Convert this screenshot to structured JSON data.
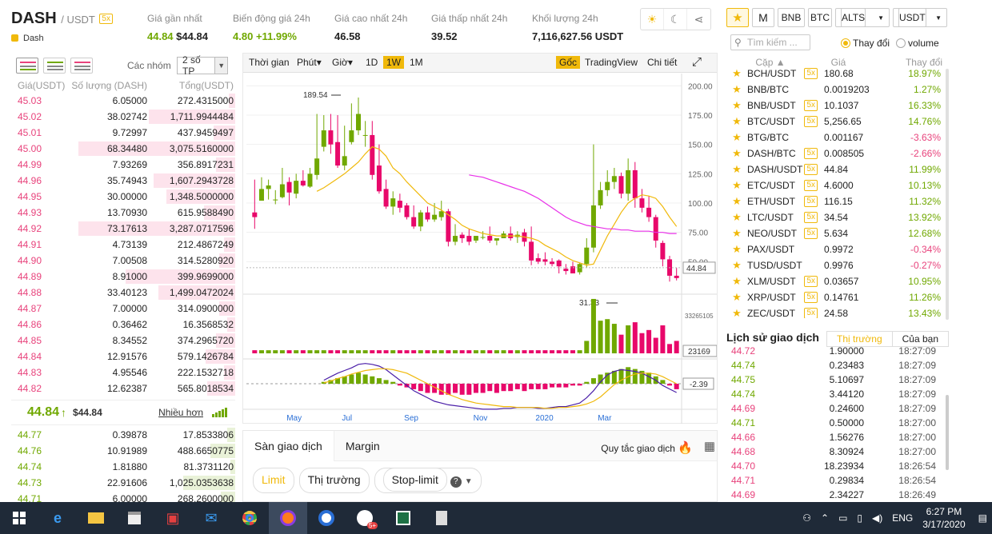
{
  "header": {
    "symbol": "DASH",
    "quote": "/ USDT",
    "leverage": "5x",
    "name": "Dash",
    "stats": [
      {
        "label": "Giá gần nhất",
        "value": "44.84",
        "value2": "$44.84"
      },
      {
        "label": "Biến động giá 24h",
        "value": "4.80",
        "value2": "+11.99%"
      },
      {
        "label": "Giá cao nhất 24h",
        "value": "46.58"
      },
      {
        "label": "Giá thấp nhất 24h",
        "value": "39.52"
      },
      {
        "label": "Khối lượng 24h",
        "value": "7,116,627.56 USDT"
      }
    ]
  },
  "orderbook": {
    "group_label": "Các nhóm",
    "group_value": "2 số TP",
    "cols": [
      "Giá(USDT)",
      "Số lượng (DASH)",
      "Tổng(USDT)"
    ],
    "asks": [
      [
        "45.03",
        "6.05000",
        "272.4315000",
        0.04
      ],
      [
        "45.02",
        "38.02742",
        "1,711.9944484",
        0.55
      ],
      [
        "45.01",
        "9.72997",
        "437.9459497",
        0.14
      ],
      [
        "45.00",
        "68.34480",
        "3,075.5160000",
        1.0
      ],
      [
        "44.99",
        "7.93269",
        "356.8917231",
        0.12
      ],
      [
        "44.96",
        "35.74943",
        "1,607.2943728",
        0.52
      ],
      [
        "44.95",
        "30.00000",
        "1,348.5000000",
        0.44
      ],
      [
        "44.93",
        "13.70930",
        "615.9588490",
        0.2
      ],
      [
        "44.92",
        "73.17613",
        "3,287.0717596",
        1.0
      ],
      [
        "44.91",
        "4.73139",
        "212.4867249",
        0.07
      ],
      [
        "44.90",
        "7.00508",
        "314.5280920",
        0.1
      ],
      [
        "44.89",
        "8.91000",
        "399.9699000",
        0.7
      ],
      [
        "44.88",
        "33.40123",
        "1,499.0472024",
        0.49
      ],
      [
        "44.87",
        "7.00000",
        "314.0900000",
        0.1
      ],
      [
        "44.86",
        "0.36462",
        "16.3568532",
        0.05
      ],
      [
        "44.85",
        "8.34552",
        "374.2965720",
        0.12
      ],
      [
        "44.84",
        "12.91576",
        "579.1426784",
        0.19
      ],
      [
        "44.83",
        "4.95546",
        "222.1532718",
        0.07
      ],
      [
        "44.82",
        "12.62387",
        "565.8018534",
        0.18
      ]
    ],
    "last_price": "44.84",
    "last_arrow": "↑",
    "last_usd": "$44.84",
    "more": "Nhiều hơn",
    "bids": [
      [
        "44.77",
        "0.39878",
        "17.8533806",
        0.05
      ],
      [
        "44.76",
        "10.91989",
        "488.6650775",
        0.16
      ],
      [
        "44.74",
        "1.81880",
        "81.3731120",
        0.03
      ],
      [
        "44.73",
        "22.91606",
        "1,025.0353638",
        0.33
      ],
      [
        "44.71",
        "6.00000",
        "268.2600000",
        0.09
      ]
    ]
  },
  "chart": {
    "toolbar": [
      "Thời gian",
      "Phút",
      "Giờ",
      "1D",
      "1W",
      "1M"
    ],
    "toolbar_right": [
      "Gốc",
      "TradingView",
      "Chi tiết"
    ],
    "price_axis": [
      "200.00",
      "175.00",
      "150.00",
      "125.00",
      "100.00",
      "75.00",
      "50.00"
    ],
    "current_price": "44.84",
    "vol_top": "33265105",
    "vol_cur": "23169",
    "macd_cur": "-2.39",
    "x_labels": [
      "May",
      "Jul",
      "Sep",
      "Nov",
      "2020",
      "Mar"
    ],
    "high_label": "189.54",
    "low_label": "31.33"
  },
  "chart_data": {
    "type": "candlestick",
    "interval": "1W",
    "ylim": [
      25,
      205
    ],
    "candles": [
      [
        92,
        120,
        88,
        78
      ],
      [
        102,
        122,
        112,
        110
      ],
      [
        112,
        120,
        115,
        103
      ],
      [
        103,
        111,
        103,
        99
      ],
      [
        105,
        130,
        116,
        104
      ],
      [
        118,
        122,
        109,
        98
      ],
      [
        108,
        125,
        119,
        104
      ],
      [
        119,
        128,
        115,
        114
      ],
      [
        114,
        130,
        125,
        113
      ],
      [
        124,
        176,
        138,
        120
      ],
      [
        148,
        175,
        162,
        144
      ],
      [
        162,
        176,
        150,
        142
      ],
      [
        152,
        175,
        132,
        130
      ],
      [
        132,
        166,
        140,
        128
      ],
      [
        152,
        185,
        162,
        150
      ],
      [
        162,
        190,
        176,
        158
      ],
      [
        158,
        170,
        158,
        148
      ],
      [
        158,
        170,
        124,
        120
      ],
      [
        132,
        150,
        110,
        108
      ],
      [
        112,
        120,
        97,
        95
      ],
      [
        97,
        110,
        104,
        90
      ],
      [
        102,
        108,
        96,
        92
      ],
      [
        98,
        100,
        88,
        86
      ],
      [
        88,
        98,
        80,
        78
      ],
      [
        80,
        94,
        92,
        76
      ],
      [
        92,
        97,
        86,
        84
      ],
      [
        86,
        100,
        90,
        84
      ],
      [
        88,
        102,
        93,
        85
      ],
      [
        93,
        95,
        67,
        63
      ],
      [
        67,
        82,
        72,
        64
      ],
      [
        73,
        75,
        70,
        66
      ],
      [
        72,
        78,
        67,
        64
      ],
      [
        68,
        72,
        72,
        66
      ],
      [
        71,
        76,
        71,
        69
      ],
      [
        72,
        80,
        68,
        66
      ],
      [
        68,
        70,
        70,
        64
      ],
      [
        70,
        76,
        74,
        70
      ],
      [
        74,
        80,
        70,
        68
      ],
      [
        71,
        76,
        73,
        66
      ],
      [
        75,
        78,
        67,
        63
      ],
      [
        67,
        80,
        51,
        47
      ],
      [
        53,
        57,
        50,
        48
      ],
      [
        52,
        58,
        50,
        47
      ],
      [
        50,
        53,
        48,
        46
      ],
      [
        51,
        52,
        46,
        40
      ],
      [
        44,
        48,
        42,
        39
      ],
      [
        46,
        50,
        40,
        40
      ],
      [
        41,
        49,
        48,
        39
      ],
      [
        48,
        70,
        62,
        45
      ],
      [
        62,
        150,
        98,
        58
      ],
      [
        98,
        118,
        111,
        95
      ],
      [
        111,
        128,
        118,
        106
      ],
      [
        118,
        130,
        123,
        112
      ],
      [
        123,
        126,
        108,
        104
      ],
      [
        108,
        138,
        128,
        102
      ],
      [
        128,
        135,
        104,
        96
      ],
      [
        104,
        112,
        96,
        92
      ],
      [
        96,
        106,
        88,
        84
      ],
      [
        88,
        90,
        68,
        62
      ],
      [
        66,
        68,
        52,
        46
      ],
      [
        52,
        55,
        38,
        33
      ],
      [
        38,
        45,
        36,
        34
      ]
    ],
    "volume": [
      2,
      2,
      2,
      2,
      2,
      2,
      2,
      2,
      2,
      2,
      2,
      2,
      2,
      2,
      2,
      2,
      2,
      2,
      2,
      2,
      2,
      2,
      2,
      2,
      2,
      2,
      2,
      2,
      2,
      2,
      2,
      2,
      2,
      2,
      2,
      2,
      2,
      2,
      2,
      2,
      2,
      2,
      2,
      2,
      2,
      2,
      2,
      2,
      8,
      35,
      21,
      22,
      19,
      12,
      18,
      20,
      13,
      15,
      10,
      18,
      6,
      8
    ],
    "ma_short": [
      0,
      0,
      0,
      0,
      0,
      0,
      0,
      0,
      0,
      110,
      113,
      117,
      121,
      125,
      130,
      135,
      142,
      148,
      146,
      140,
      130,
      125,
      118,
      112,
      106,
      100,
      97,
      94,
      90,
      86,
      81,
      78,
      76,
      74,
      73,
      72,
      72,
      72,
      72,
      71,
      70,
      68,
      64,
      61,
      58,
      54,
      51,
      49,
      47,
      48,
      60,
      72,
      82,
      92,
      100,
      104,
      107,
      106,
      104,
      97,
      88,
      80
    ],
    "ma_long": [
      0,
      0,
      0,
      0,
      0,
      0,
      0,
      0,
      0,
      0,
      0,
      0,
      0,
      0,
      0,
      0,
      0,
      0,
      0,
      0,
      0,
      0,
      0,
      0,
      0,
      0,
      0,
      0,
      0,
      0,
      0,
      124,
      123,
      122,
      120,
      118,
      116,
      114,
      112,
      110,
      107,
      104,
      100,
      96,
      92,
      88,
      85,
      83,
      81,
      80,
      79,
      78,
      78,
      77,
      77,
      76,
      76,
      76,
      75,
      75,
      74,
      74
    ],
    "macd_hist": [
      0,
      0,
      0,
      0,
      0,
      0,
      0,
      0,
      0,
      0,
      1,
      2,
      3,
      4,
      5,
      6,
      5,
      4,
      3,
      2,
      1,
      -1,
      -2,
      -3,
      -4,
      -5,
      -5,
      -6,
      -6,
      -5,
      -6,
      -6,
      -5,
      -5,
      -4,
      -5,
      -4,
      -4,
      -3,
      -4,
      -3,
      -3,
      -3,
      -2,
      -2,
      -2,
      -1,
      -1,
      1,
      3,
      5,
      6,
      7,
      8,
      9,
      8,
      7,
      6,
      4,
      2,
      -1,
      -3
    ],
    "macd_line": [
      0,
      0,
      0,
      0,
      0,
      0,
      0,
      0,
      0,
      0,
      4,
      8,
      12,
      15,
      18,
      22,
      23,
      22,
      20,
      16,
      10,
      4,
      -2,
      -8,
      -12,
      -16,
      -20,
      -22,
      -24,
      -25,
      -26,
      -27,
      -28,
      -29,
      -29,
      -29,
      -28,
      -28,
      -27,
      -27,
      -27,
      -28,
      -28,
      -27,
      -26,
      -26,
      -24,
      -22,
      -16,
      -8,
      2,
      10,
      14,
      16,
      15,
      14,
      12,
      8,
      4,
      -2,
      -6,
      -10
    ],
    "signal_line": [
      0,
      0,
      0,
      0,
      0,
      0,
      0,
      0,
      0,
      0,
      1,
      3,
      6,
      8,
      11,
      13,
      15,
      16,
      17,
      17,
      16,
      14,
      12,
      8,
      4,
      0,
      -4,
      -8,
      -12,
      -15,
      -18,
      -20,
      -22,
      -23,
      -24,
      -25,
      -26,
      -26,
      -27,
      -27,
      -27,
      -27,
      -28,
      -28,
      -27,
      -27,
      -26,
      -25,
      -23,
      -20,
      -15,
      -8,
      -1,
      4,
      8,
      11,
      12,
      12,
      11,
      8,
      4,
      0
    ]
  },
  "trade": {
    "tabs": [
      "Sàn giao dịch",
      "Margin"
    ],
    "rules": "Quy tắc giao dịch",
    "order_types": [
      "Limit",
      "Thị trường",
      "Stop-limit"
    ]
  },
  "markets": {
    "tabs": [
      "M",
      "BNB",
      "BTC",
      "ALTS",
      "USDT"
    ],
    "search_placeholder": "Tìm kiếm ...",
    "toggle_change": "Thay đổi",
    "toggle_volume": "volume",
    "cols": [
      "Cặp",
      "Giá",
      "Thay đổi"
    ],
    "rows": [
      [
        "BCH/USDT",
        "5x",
        "180.68",
        "18.97%"
      ],
      [
        "BNB/BTC",
        "",
        "0.0019203",
        "1.27%"
      ],
      [
        "BNB/USDT",
        "5x",
        "10.1037",
        "16.33%"
      ],
      [
        "BTC/USDT",
        "5x",
        "5,256.65",
        "14.76%"
      ],
      [
        "BTG/BTC",
        "",
        "0.001167",
        "-3.63%"
      ],
      [
        "DASH/BTC",
        "5x",
        "0.008505",
        "-2.66%"
      ],
      [
        "DASH/USDT",
        "5x",
        "44.84",
        "11.99%"
      ],
      [
        "ETC/USDT",
        "5x",
        "4.6000",
        "10.13%"
      ],
      [
        "ETH/USDT",
        "5x",
        "116.15",
        "11.32%"
      ],
      [
        "LTC/USDT",
        "5x",
        "34.54",
        "13.92%"
      ],
      [
        "NEO/USDT",
        "5x",
        "5.634",
        "12.68%"
      ],
      [
        "PAX/USDT",
        "",
        "0.9972",
        "-0.34%"
      ],
      [
        "TUSD/USDT",
        "",
        "0.9976",
        "-0.27%"
      ],
      [
        "XLM/USDT",
        "5x",
        "0.03657",
        "10.95%"
      ],
      [
        "XRP/USDT",
        "5x",
        "0.14761",
        "11.26%"
      ],
      [
        "ZEC/USDT",
        "5x",
        "24.58",
        "13.43%"
      ]
    ]
  },
  "history": {
    "title": "Lịch sử giao dịch",
    "tabs": [
      "Thị trường",
      "Của bạn"
    ],
    "rows": [
      [
        "44.72",
        "1.90000",
        "18:27:09",
        "a"
      ],
      [
        "44.74",
        "0.23483",
        "18:27:09",
        "b"
      ],
      [
        "44.75",
        "5.10697",
        "18:27:09",
        "b"
      ],
      [
        "44.74",
        "3.44120",
        "18:27:09",
        "b"
      ],
      [
        "44.69",
        "0.24600",
        "18:27:09",
        "a"
      ],
      [
        "44.71",
        "0.50000",
        "18:27:00",
        "b"
      ],
      [
        "44.66",
        "1.56276",
        "18:27:00",
        "a"
      ],
      [
        "44.68",
        "8.30924",
        "18:27:00",
        "a"
      ],
      [
        "44.70",
        "18.23934",
        "18:26:54",
        "a"
      ],
      [
        "44.71",
        "0.29834",
        "18:26:54",
        "a"
      ],
      [
        "44.69",
        "2.34227",
        "18:26:49",
        "a"
      ]
    ]
  },
  "taskbar": {
    "lang": "ENG",
    "time": "6:27 PM",
    "date": "3/17/2020",
    "badge": "5+"
  }
}
